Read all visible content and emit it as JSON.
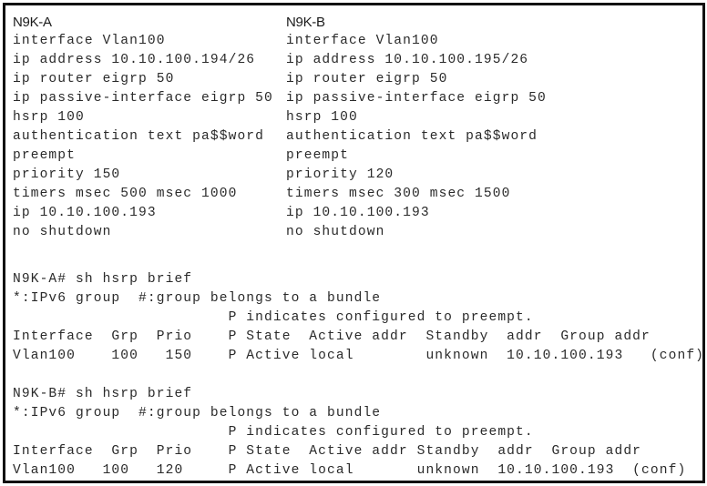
{
  "devices": [
    {
      "name": "N9K-A",
      "config": [
        "interface Vlan100",
        "ip address 10.10.100.194/26",
        "ip router eigrp 50",
        "ip passive-interface eigrp 50",
        "hsrp 100",
        "authentication text pa$$word",
        "preempt",
        "priority 150",
        "timers msec 500 msec 1000",
        "ip 10.10.100.193",
        "no shutdown"
      ]
    },
    {
      "name": "N9K-B",
      "config": [
        "interface Vlan100",
        "ip address 10.10.100.195/26",
        "ip router eigrp 50",
        "ip passive-interface eigrp 50",
        "hsrp 100",
        "authentication text pa$$word",
        "preempt",
        "priority 120",
        "timers msec 300 msec 1500",
        "ip 10.10.100.193",
        "no shutdown"
      ]
    }
  ],
  "outputs": [
    {
      "command": "N9K-A# sh hsrp brief",
      "legend1": "*:IPv6 group  #:group belongs to a bundle",
      "legend2": "                        P indicates configured to preempt.",
      "header": "Interface  Grp  Prio    P State  Active addr  Standby  addr  Group addr",
      "row": "Vlan100    100   150    P Active local        unknown  10.10.100.193   (conf)",
      "fields": {
        "interface": "Vlan100",
        "group": "100",
        "priority": "150",
        "preempt": "P",
        "state": "Active",
        "active_addr": "local",
        "standby_addr": "unknown",
        "group_addr": "10.10.100.193",
        "flag": "(conf)"
      }
    },
    {
      "command": "N9K-B# sh hsrp brief",
      "legend1": "*:IPv6 group  #:group belongs to a bundle",
      "legend2": "                        P indicates configured to preempt.",
      "header": "Interface  Grp  Prio    P State  Active addr Standby  addr  Group addr",
      "row": "Vlan100   100   120     P Active local       unknown  10.10.100.193  (conf)",
      "fields": {
        "interface": "Vlan100",
        "group": "100",
        "priority": "120",
        "preempt": "P",
        "state": "Active",
        "active_addr": "local",
        "standby_addr": "unknown",
        "group_addr": "10.10.100.193",
        "flag": "(conf)"
      }
    }
  ]
}
